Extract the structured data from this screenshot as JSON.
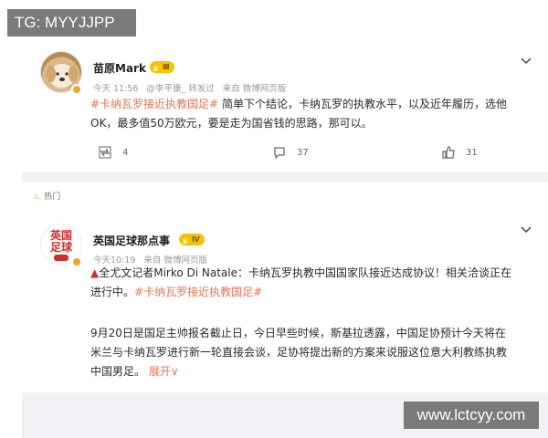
{
  "watermark_top": "TG: MYYJJPP",
  "watermark_bottom": "www.lctcyy.com",
  "post1": {
    "author": "苗原Mark",
    "level": "Ⅲ",
    "time": "今天 11:56",
    "via": "@李平康_ 转发过",
    "source": "来自 微博网页版",
    "hashtag": "#卡纳瓦罗接近执教国足#",
    "text_line1": " 简单下个结论，卡纳瓦罗的执教水平，以及近年履历，选他",
    "text_line2": "OK，最多值50万欧元，要是走为国省钱的思路，那可以。",
    "reposts": "4",
    "comments": "37",
    "likes": "31"
  },
  "hot_label": "热门",
  "post2": {
    "author": "英国足球那点事",
    "level": "Ⅳ",
    "avatar_text_a": "英国",
    "avatar_text_b": "足球",
    "time": "今天10:19",
    "source": "来自 微博网页版",
    "line1": "全尤文记者Mirko Di Natale：卡纳瓦罗执教中国国家队接近达成协议！相关洽谈正在",
    "line2_pre": "进行中。",
    "hashtag": "#卡纳瓦罗接近执教国足#",
    "para2_line1": "9月20日是国足主帅报名截止日，今日早些时候，斯基拉透露，中国足协预计今天将在",
    "para2_line2": "米兰与卡纳瓦罗进行新一轮直接会谈，足协将提出新的方案来说服这位意大利教练执教",
    "para2_line3": "中国男足。",
    "expand": "展开"
  },
  "colors": {
    "accent": "#eb7350",
    "level_badge": "#f3c400",
    "divider": "#f1f2f5"
  }
}
